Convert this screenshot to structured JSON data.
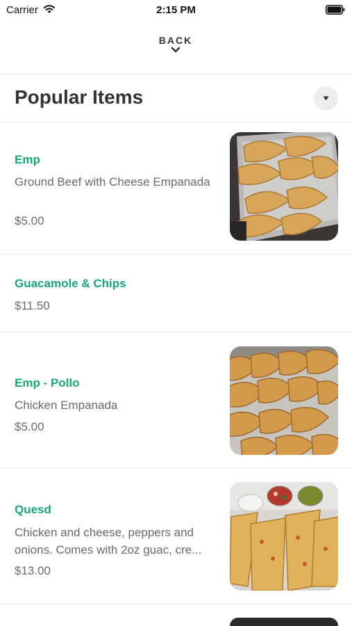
{
  "status_bar": {
    "carrier": "Carrier",
    "time": "2:15 PM"
  },
  "nav": {
    "back_label": "BACK"
  },
  "section": {
    "title": "Popular Items"
  },
  "items": [
    {
      "name": "Emp",
      "description": "Ground Beef with Cheese Empanada",
      "price": "$5.00",
      "has_image": true,
      "image": "empanadas-tray"
    },
    {
      "name": "Guacamole & Chips",
      "description": "",
      "price": "$11.50",
      "has_image": false
    },
    {
      "name": "Emp - Pollo",
      "description": "Chicken Empanada",
      "price": "$5.00",
      "has_image": true,
      "image": "chicken-empanadas"
    },
    {
      "name": "Quesd",
      "description_line1": "Chicken and cheese, peppers and",
      "description_line2": "onions. Comes with 2oz guac, cre...",
      "price": "$13.00",
      "has_image": true,
      "image": "quesadilla-plate"
    }
  ],
  "colors": {
    "accent": "#17a874",
    "text": "#333333",
    "muted": "#6b6b6b"
  }
}
